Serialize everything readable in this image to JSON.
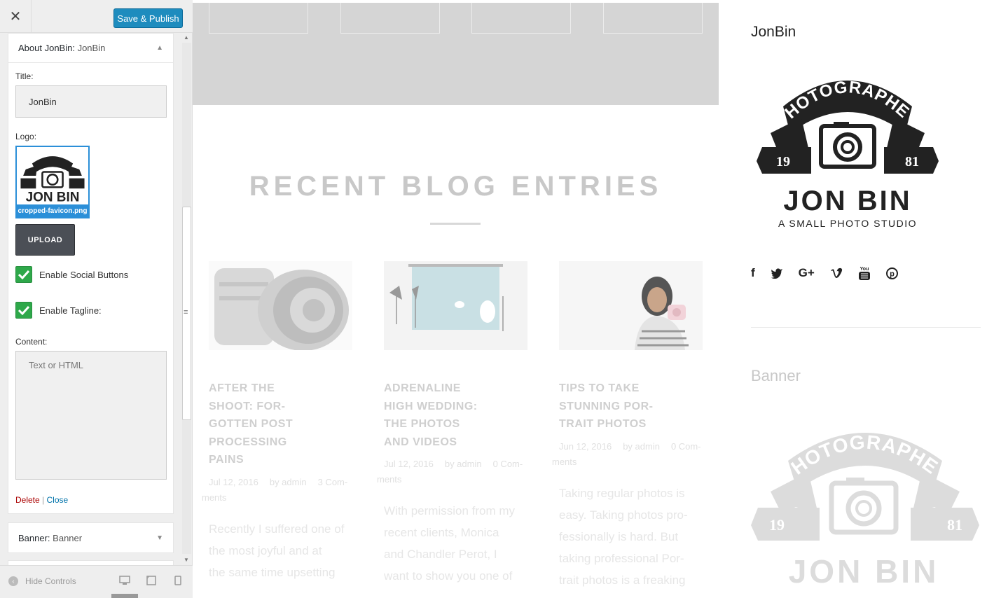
{
  "panel": {
    "close_glyph": "✕",
    "publish_label": "Save & Publish",
    "widget_about": {
      "head_prefix": "About JonBin:",
      "head_sub": "JonBin",
      "title_label": "Title:",
      "title_value": "JonBin",
      "logo_label": "Logo:",
      "logo_filename": "cropped-favicon.png",
      "upload_label": "UPLOAD",
      "enable_social_label": "Enable Social Buttons",
      "enable_tagline_label": "Enable Tagline:",
      "content_label": "Content:",
      "content_placeholder": "Text or HTML",
      "delete_label": "Delete",
      "separator": "|",
      "close_label": "Close"
    },
    "widget_banner": {
      "head_prefix": "Banner:",
      "head_sub": "Banner"
    },
    "footer": {
      "hide_controls_label": "Hide Controls"
    }
  },
  "logo": {
    "ribbon_text": "PHOTOGRAPHER",
    "year_left": "19",
    "year_right": "81",
    "name": "JON BIN",
    "tagline": "A SMALL PHOTO STUDIO"
  },
  "preview": {
    "section_title": "RECENT BLOG ENTRIES",
    "posts": [
      {
        "title_lines": [
          "AFTER THE",
          "SHOOT: FOR-",
          "GOTTEN POST",
          "PROCESSING",
          "PAINS"
        ],
        "date": "Jul 12, 2016",
        "author": "by admin",
        "comments": "3 Com-",
        "comments_cont": "ments",
        "excerpt_lines": [
          "Recently I suffered one of",
          "the most joyful and at",
          "the same time upsetting"
        ]
      },
      {
        "title_lines": [
          "ADRENALINE",
          "HIGH WEDDING:",
          "THE PHOTOS",
          "AND VIDEOS"
        ],
        "date": "Jul 12, 2016",
        "author": "by admin",
        "comments": "0 Com-",
        "comments_cont": "ments",
        "excerpt_lines": [
          "With permission from my",
          "recent clients, Monica",
          "and Chandler Perot, I",
          "want to show you one of"
        ]
      },
      {
        "title_lines": [
          "TIPS TO TAKE",
          "STUNNING POR-",
          "TRAIT PHOTOS"
        ],
        "date": "Jun 12, 2016",
        "author": "by admin",
        "comments": "0 Com-",
        "comments_cont": "ments",
        "excerpt_lines": [
          "Taking regular photos is",
          "easy. Taking photos pro-",
          "fessionally is hard. But",
          "taking professional Por-",
          "trait photos is a freaking"
        ]
      }
    ]
  },
  "sidebar": {
    "widget_title": "JonBin",
    "social_icons": [
      "facebook-icon",
      "twitter-icon",
      "google-plus-icon",
      "vimeo-icon",
      "youtube-icon",
      "pinterest-icon"
    ],
    "social_glyphs": [
      "f",
      "t",
      "G+",
      "v",
      "You",
      "p"
    ],
    "banner_title": "Banner"
  },
  "colors": {
    "publish_blue": "#1e8cbe",
    "check_green": "#2ea84a",
    "logo_dark": "#222222",
    "delete_red": "#aa0000",
    "link_blue": "#0073aa"
  }
}
